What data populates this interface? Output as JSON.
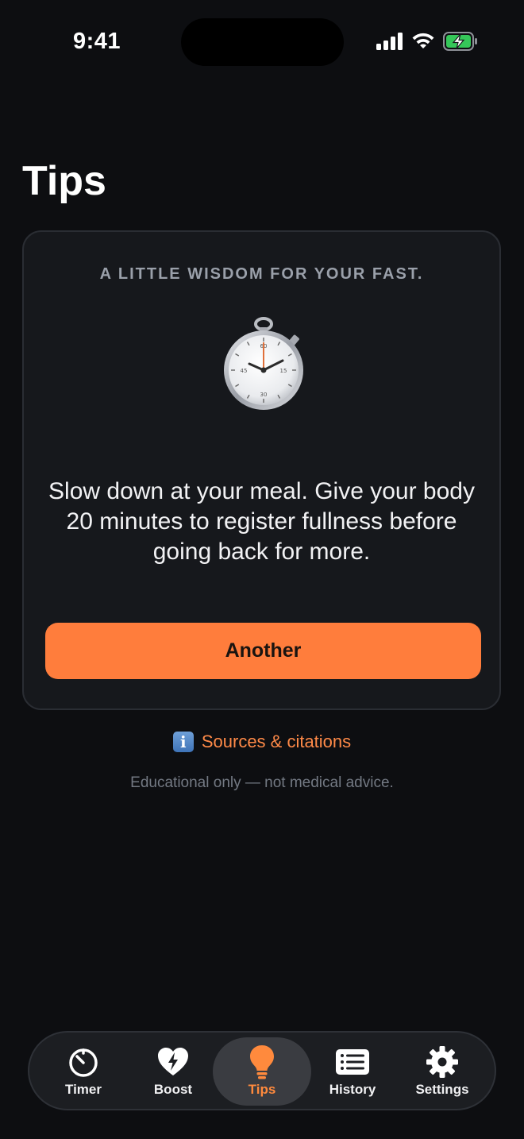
{
  "status_bar": {
    "time": "9:41"
  },
  "page": {
    "title": "Tips"
  },
  "card": {
    "kicker": "A LITTLE WISDOM FOR YOUR FAST.",
    "icon": "stopwatch-icon",
    "tip": "Slow down at your meal. Give your body 20 minutes to register fullness before going back for more.",
    "button_label": "Another"
  },
  "sources": {
    "icon": "info-icon",
    "info_glyph": "i",
    "label": "Sources & citations"
  },
  "disclaimer": "Educational only — not medical advice.",
  "tab_bar": {
    "items": [
      {
        "label": "Timer",
        "icon": "timer-icon"
      },
      {
        "label": "Boost",
        "icon": "heart-bolt-icon"
      },
      {
        "label": "Tips",
        "icon": "lightbulb-icon",
        "active": true
      },
      {
        "label": "History",
        "icon": "list-icon"
      },
      {
        "label": "Settings",
        "icon": "gear-icon"
      }
    ]
  },
  "colors": {
    "background": "#0d0e11",
    "card": "#16181c",
    "accent": "#ff7d3c",
    "link": "#ff8a48",
    "muted": "#737983"
  }
}
